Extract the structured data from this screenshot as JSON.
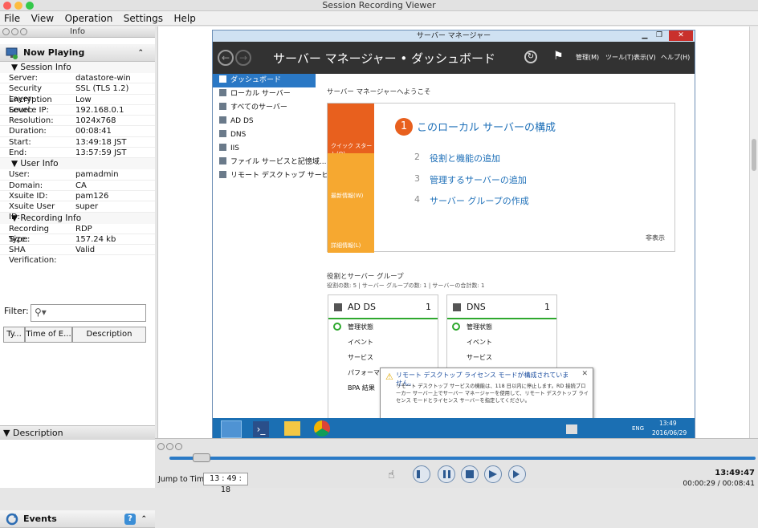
{
  "window": {
    "title": "Session Recording Viewer"
  },
  "menu": [
    "File",
    "View",
    "Operation",
    "Settings",
    "Help"
  ],
  "info_panel": {
    "title": "Info",
    "now_playing": "Now Playing",
    "session_info": {
      "title": "Session Info",
      "rows": [
        {
          "label": "Server:",
          "value": "datastore-win"
        },
        {
          "label": "Security Layer:",
          "value": "SSL (TLS 1.2)"
        },
        {
          "label": "Encryption Level:",
          "value": "Low"
        },
        {
          "label": "Source IP:",
          "value": "192.168.0.1"
        },
        {
          "label": "Resolution:",
          "value": "1024x768"
        },
        {
          "label": "Duration:",
          "value": "00:08:41"
        },
        {
          "label": "Start:",
          "value": "13:49:18 JST"
        },
        {
          "label": "End:",
          "value": "13:57:59 JST"
        }
      ]
    },
    "user_info": {
      "title": "User Info",
      "rows": [
        {
          "label": "User:",
          "value": "pamadmin"
        },
        {
          "label": "Domain:",
          "value": "CA"
        },
        {
          "label": "Xsuite ID:",
          "value": "pam126"
        },
        {
          "label": "Xsuite User ID:",
          "value": "super"
        }
      ]
    },
    "recording_info": {
      "title": "Recording Info",
      "rows": [
        {
          "label": "Recording Type:",
          "value": "RDP"
        },
        {
          "label": "Size:",
          "value": "157.24 kb"
        },
        {
          "label": "SHA Verification:",
          "value": "Valid"
        }
      ]
    }
  },
  "events_panel": {
    "title": "Events",
    "filter_label": "Filter:",
    "columns": [
      "Ty...",
      "Time of E...",
      "Description"
    ]
  },
  "description_panel": {
    "title": "Description"
  },
  "rdp": {
    "title": "サーバー マネージャー",
    "header": "サーバー マネージャー • ダッシュボード",
    "menus": [
      "管理(M)",
      "ツール(T)",
      "表示(V)",
      "ヘルプ(H)"
    ],
    "nav": [
      "ダッシュボード",
      "ローカル サーバー",
      "すべてのサーバー",
      "AD DS",
      "DNS",
      "IIS",
      "ファイル サービスと記憶域...",
      "リモート デスクトップ サービス"
    ],
    "welcome_label": "サーバー マネージャーへようこそ",
    "tiles": [
      "クイック スタート(Q)",
      "最新情報(W)",
      "詳細情報(L)"
    ],
    "configure": {
      "number": "1",
      "text": "このローカル サーバーの構成"
    },
    "steps": [
      {
        "number": "2",
        "text": "役割と機能の追加"
      },
      {
        "number": "3",
        "text": "管理するサーバーの追加"
      },
      {
        "number": "4",
        "text": "サーバー グループの作成"
      }
    ],
    "hide": "非表示",
    "roles_title": "役割とサーバー グループ",
    "roles_sub": "役割の数: 5  |  サーバー グループの数: 1  |  サーバーの合計数: 1",
    "cards": [
      {
        "name": "AD DS",
        "count": "1",
        "rows": [
          "管理状態",
          "イベント",
          "サービス",
          "パフォーマンス",
          "BPA 結果"
        ]
      },
      {
        "name": "DNS",
        "count": "1",
        "rows": [
          "管理状態",
          "イベント",
          "サービス"
        ]
      }
    ],
    "popup": {
      "title": "リモート デスクトップ ライセンス モードが構成されていません。",
      "body": "リモート デスクトップ サービスの機能は、118 日以内に停止します。RD 接続ブローカー サーバー上でサーバー マネージャーを使用して、リモート デスクトップ ライセンス モードとライセンス サーバーを指定してください。"
    },
    "taskbar": {
      "lang": "ENG",
      "time": "13:49",
      "date": "2016/06/29"
    }
  },
  "player": {
    "jump_label": "Jump to Time:",
    "jump_value": "13 : 49 : 18",
    "clock": "13:49:47",
    "elapsed": "00:00:29 / 00:08:41",
    "progress": 0.055
  }
}
